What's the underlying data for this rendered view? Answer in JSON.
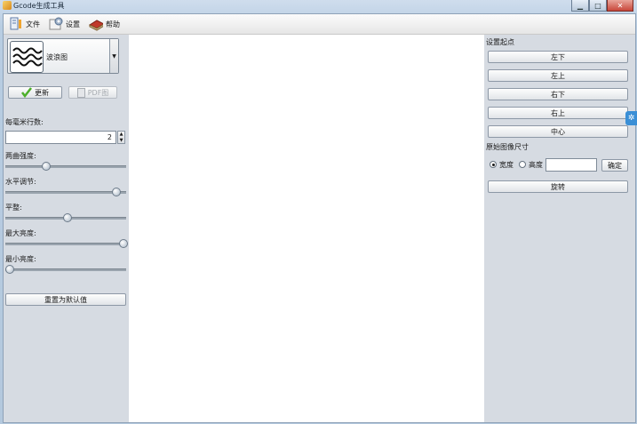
{
  "window": {
    "title": "Gcode生成工具"
  },
  "toolbar": {
    "file": "文件",
    "settings": "设置",
    "help": "帮助"
  },
  "left": {
    "pattern": {
      "name": "波浪图"
    },
    "update_btn": "更新",
    "pdf_btn": "PDF图",
    "lines_label": "每毫米行数:",
    "lines_value": "2",
    "sliders": [
      {
        "label": "两曲强度:",
        "value": 0.32
      },
      {
        "label": "水平调节:",
        "value": 0.94
      },
      {
        "label": "平整:",
        "value": 0.51
      },
      {
        "label": "最大亮度:",
        "value": 1.0
      },
      {
        "label": "最小亮度:",
        "value": 0.0
      }
    ],
    "reset_btn": "重置为默认值"
  },
  "right": {
    "start_label": "设置起点",
    "start_btns": [
      "左下",
      "左上",
      "右下",
      "右上",
      "中心"
    ],
    "size_label": "原始图像尺寸",
    "radio_width": "宽度",
    "radio_height": "高度",
    "confirm_btn": "确定",
    "rotate_btn": "旋转"
  },
  "colors": {
    "accent": "#3a8fd6",
    "check": "#4caf2a"
  }
}
